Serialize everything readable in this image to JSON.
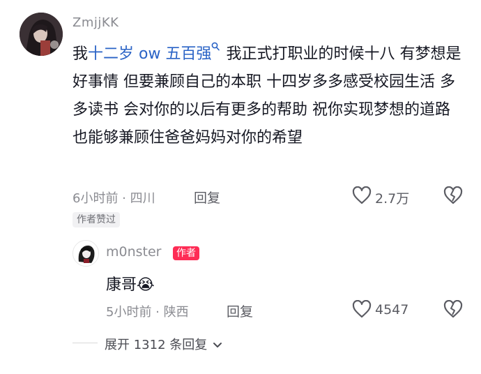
{
  "comment": {
    "author": "ZmjjKK",
    "text_before": "我",
    "highlight": "十二岁 ow 五百强",
    "text_after": " 我正式打职业的时候十八 有梦想是好事情 但要兼顾自己的本职 十四岁多多感受校园生活 多多读书 会对你的以后有更多的帮助 祝你实现梦想的道路也能够兼顾住爸爸妈妈对你的希望",
    "meta": "6小时前 · 四川",
    "reply_label": "回复",
    "likes": "2.7万",
    "badge": "作者赞过"
  },
  "reply": {
    "author": "m0nster",
    "author_tag": "作者",
    "text": "康哥😭",
    "meta": "5小时前 · 陕西",
    "reply_label": "回复",
    "likes": "4547"
  },
  "expand": {
    "label": "展开 1312 条回复"
  },
  "colors": {
    "highlight": "#2a63c6",
    "author_tag": "#fe2c55",
    "secondary_text": "#8a8b91"
  },
  "icons": [
    "heart-icon",
    "broken-heart-icon",
    "search-icon",
    "chevron-down-icon"
  ]
}
